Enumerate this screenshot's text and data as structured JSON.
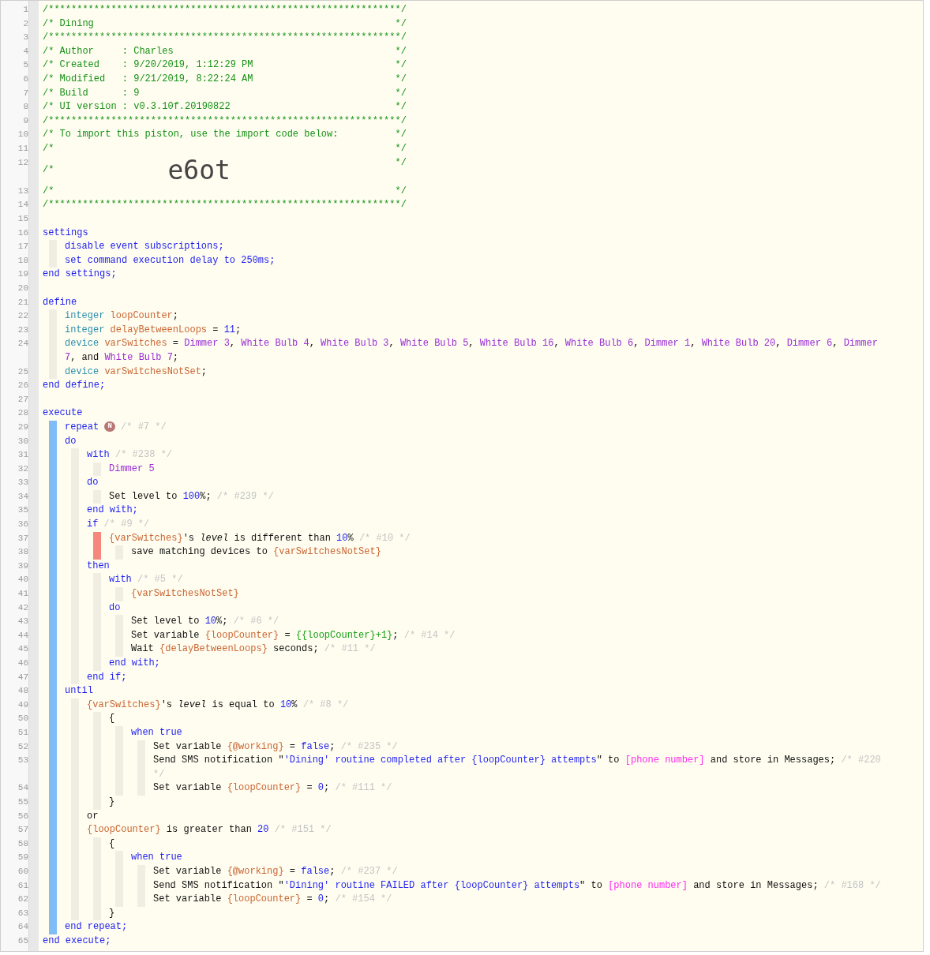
{
  "editor": {
    "lines": [
      {
        "number": "1",
        "segments": [
          {
            "kind": "cmt",
            "text": "/*************************************************************"
          }
        ],
        "close": "*/"
      },
      {
        "number": "2",
        "segments": [
          {
            "kind": "cmt",
            "text": "/* Dining"
          }
        ],
        "close": "*/"
      },
      {
        "number": "3",
        "segments": [
          {
            "kind": "cmt",
            "text": "/*************************************************************"
          }
        ],
        "close": "*/"
      },
      {
        "number": "4",
        "segments": [
          {
            "kind": "cmt",
            "text": "/* Author     : Charles"
          }
        ],
        "close": "*/"
      },
      {
        "number": "5",
        "segments": [
          {
            "kind": "cmt",
            "text": "/* Created    : 9/20/2019, 1:12:29 PM"
          }
        ],
        "close": "*/"
      },
      {
        "number": "6",
        "segments": [
          {
            "kind": "cmt",
            "text": "/* Modified   : 9/21/2019, 8:22:24 AM"
          }
        ],
        "close": "*/"
      },
      {
        "number": "7",
        "segments": [
          {
            "kind": "cmt",
            "text": "/* Build      : 9"
          }
        ],
        "close": "*/"
      },
      {
        "number": "8",
        "segments": [
          {
            "kind": "cmt",
            "text": "/* UI version : v0.3.10f.20190822"
          }
        ],
        "close": "*/"
      },
      {
        "number": "9",
        "segments": [
          {
            "kind": "cmt",
            "text": "/*************************************************************"
          }
        ],
        "close": "*/"
      },
      {
        "number": "10",
        "segments": [
          {
            "kind": "cmt",
            "text": "/* To import this piston, use the import code below:"
          }
        ],
        "close": "*/"
      },
      {
        "number": "11",
        "segments": [
          {
            "kind": "cmt",
            "text": "/*"
          }
        ],
        "close": "*/"
      },
      {
        "number": "12",
        "segments": [
          {
            "kind": "cmt",
            "text": "/*"
          },
          {
            "kind": "big",
            "text": "e6ot"
          }
        ],
        "close": "*/"
      },
      {
        "number": "13",
        "segments": [
          {
            "kind": "cmt",
            "text": "/*"
          }
        ],
        "close": "*/"
      },
      {
        "number": "14",
        "segments": [
          {
            "kind": "cmt",
            "text": "/*************************************************************"
          }
        ],
        "close": "*/"
      },
      {
        "number": "15"
      },
      {
        "number": "16",
        "segments": [
          {
            "kind": "kw",
            "text": "settings"
          }
        ],
        "children": [
          {
            "number": "17",
            "segments": [
              {
                "kind": "kw",
                "text": "disable event subscriptions;"
              }
            ]
          },
          {
            "number": "18",
            "segments": [
              {
                "kind": "kw",
                "text": "set command execution delay to 250ms;"
              }
            ]
          }
        ]
      },
      {
        "number": "19",
        "segments": [
          {
            "kind": "kw",
            "text": "end settings;"
          }
        ]
      },
      {
        "number": "20"
      },
      {
        "number": "21",
        "segments": [
          {
            "kind": "kw",
            "text": "define"
          }
        ],
        "children": [
          {
            "number": "22",
            "segments": [
              {
                "kind": "type",
                "text": "integer "
              },
              {
                "kind": "var",
                "text": "loopCounter"
              },
              {
                "kind": "txt",
                "text": ";"
              }
            ]
          },
          {
            "number": "23",
            "segments": [
              {
                "kind": "type",
                "text": "integer "
              },
              {
                "kind": "var",
                "text": "delayBetweenLoops"
              },
              {
                "kind": "txt",
                "text": " = "
              },
              {
                "kind": "num",
                "text": "11"
              },
              {
                "kind": "txt",
                "text": ";"
              }
            ]
          },
          {
            "number": "24",
            "segments": [
              {
                "kind": "type",
                "text": "device "
              },
              {
                "kind": "var",
                "text": "varSwitches"
              },
              {
                "kind": "txt",
                "text": " = "
              },
              {
                "kind": "dev",
                "text": "Dimmer 3"
              },
              {
                "kind": "txt",
                "text": ", "
              },
              {
                "kind": "dev",
                "text": "White Bulb 4"
              },
              {
                "kind": "txt",
                "text": ", "
              },
              {
                "kind": "dev",
                "text": "White Bulb 3"
              },
              {
                "kind": "txt",
                "text": ", "
              },
              {
                "kind": "dev",
                "text": "White Bulb 5"
              },
              {
                "kind": "txt",
                "text": ", "
              },
              {
                "kind": "dev",
                "text": "White Bulb 16"
              },
              {
                "kind": "txt",
                "text": ", "
              },
              {
                "kind": "dev",
                "text": "White Bulb 6"
              },
              {
                "kind": "txt",
                "text": ", "
              },
              {
                "kind": "dev",
                "text": "Dimmer 1"
              },
              {
                "kind": "txt",
                "text": ", "
              },
              {
                "kind": "dev",
                "text": "White Bulb 20"
              },
              {
                "kind": "txt",
                "text": ", "
              },
              {
                "kind": "dev",
                "text": "Dimmer 6"
              },
              {
                "kind": "txt",
                "text": ", "
              },
              {
                "kind": "dev",
                "text": "Dimmer 7"
              },
              {
                "kind": "txt",
                "text": ", and "
              },
              {
                "kind": "dev",
                "text": "White Bulb 7"
              },
              {
                "kind": "txt",
                "text": ";"
              }
            ]
          },
          {
            "number": "25",
            "segments": [
              {
                "kind": "type",
                "text": "device "
              },
              {
                "kind": "var",
                "text": "varSwitchesNotSet"
              },
              {
                "kind": "txt",
                "text": ";"
              }
            ]
          }
        ]
      },
      {
        "number": "26",
        "segments": [
          {
            "kind": "kw",
            "text": "end define;"
          }
        ]
      },
      {
        "number": "27"
      },
      {
        "number": "28",
        "segments": [
          {
            "kind": "kw",
            "text": "execute"
          }
        ],
        "color": "#80bdf7",
        "children": [
          {
            "number": "29",
            "segments": [
              {
                "kind": "kw",
                "text": "repeat "
              },
              {
                "kind": "badge",
                "text": "N"
              },
              {
                "kind": "dim",
                "text": " /* #7 */"
              }
            ]
          },
          {
            "number": "30",
            "segments": [
              {
                "kind": "kw",
                "text": "do"
              }
            ],
            "children": [
              {
                "number": "31",
                "segments": [
                  {
                    "kind": "kw",
                    "text": "with "
                  },
                  {
                    "kind": "dim",
                    "text": "/* #238 */"
                  }
                ],
                "children": [
                  {
                    "number": "32",
                    "segments": [
                      {
                        "kind": "dev",
                        "text": "Dimmer 5"
                      }
                    ]
                  }
                ]
              },
              {
                "number": "33",
                "segments": [
                  {
                    "kind": "kw",
                    "text": "do"
                  }
                ],
                "children": [
                  {
                    "number": "34",
                    "segments": [
                      {
                        "kind": "txt",
                        "text": "Set level to "
                      },
                      {
                        "kind": "num",
                        "text": "100"
                      },
                      {
                        "kind": "txt",
                        "text": "%; "
                      },
                      {
                        "kind": "dim",
                        "text": "/* #239 */"
                      }
                    ]
                  }
                ]
              },
              {
                "number": "35",
                "segments": [
                  {
                    "kind": "kw",
                    "text": "end with;"
                  }
                ]
              },
              {
                "number": "36",
                "segments": [
                  {
                    "kind": "kw",
                    "text": "if "
                  },
                  {
                    "kind": "dim",
                    "text": "/* #9 */"
                  }
                ],
                "color": "#f6877c",
                "children": [
                  {
                    "number": "37",
                    "segments": [
                      {
                        "kind": "var",
                        "text": "{varSwitches}"
                      },
                      {
                        "kind": "txt",
                        "text": "'s "
                      },
                      {
                        "kind": "it",
                        "text": "level"
                      },
                      {
                        "kind": "txt",
                        "text": " is different than "
                      },
                      {
                        "kind": "num",
                        "text": "10"
                      },
                      {
                        "kind": "txt",
                        "text": "% "
                      },
                      {
                        "kind": "dim",
                        "text": "/* #10 */"
                      }
                    ],
                    "children": [
                      {
                        "number": "38",
                        "segments": [
                          {
                            "kind": "txt",
                            "text": "save matching devices to "
                          },
                          {
                            "kind": "var",
                            "text": "{varSwitchesNotSet}"
                          }
                        ]
                      }
                    ]
                  }
                ]
              },
              {
                "number": "39",
                "segments": [
                  {
                    "kind": "kw",
                    "text": "then"
                  }
                ],
                "children": [
                  {
                    "number": "40",
                    "segments": [
                      {
                        "kind": "kw",
                        "text": "with "
                      },
                      {
                        "kind": "dim",
                        "text": "/* #5 */"
                      }
                    ],
                    "children": [
                      {
                        "number": "41",
                        "segments": [
                          {
                            "kind": "var",
                            "text": "{varSwitchesNotSet}"
                          }
                        ]
                      }
                    ]
                  },
                  {
                    "number": "42",
                    "segments": [
                      {
                        "kind": "kw",
                        "text": "do"
                      }
                    ],
                    "children": [
                      {
                        "number": "43",
                        "segments": [
                          {
                            "kind": "txt",
                            "text": "Set level to "
                          },
                          {
                            "kind": "num",
                            "text": "10"
                          },
                          {
                            "kind": "txt",
                            "text": "%; "
                          },
                          {
                            "kind": "dim",
                            "text": "/* #6 */"
                          }
                        ]
                      },
                      {
                        "number": "44",
                        "segments": [
                          {
                            "kind": "txt",
                            "text": "Set variable "
                          },
                          {
                            "kind": "var",
                            "text": "{loopCounter}"
                          },
                          {
                            "kind": "txt",
                            "text": " = "
                          },
                          {
                            "kind": "expr",
                            "text": "{{loopCounter}+1}"
                          },
                          {
                            "kind": "txt",
                            "text": "; "
                          },
                          {
                            "kind": "dim",
                            "text": "/* #14 */"
                          }
                        ]
                      },
                      {
                        "number": "45",
                        "segments": [
                          {
                            "kind": "txt",
                            "text": "Wait "
                          },
                          {
                            "kind": "var",
                            "text": "{delayBetweenLoops}"
                          },
                          {
                            "kind": "txt",
                            "text": " seconds; "
                          },
                          {
                            "kind": "dim",
                            "text": "/* #11 */"
                          }
                        ]
                      }
                    ]
                  },
                  {
                    "number": "46",
                    "segments": [
                      {
                        "kind": "kw",
                        "text": "end with;"
                      }
                    ]
                  }
                ]
              },
              {
                "number": "47",
                "segments": [
                  {
                    "kind": "kw",
                    "text": "end if;"
                  }
                ]
              }
            ]
          },
          {
            "number": "48",
            "segments": [
              {
                "kind": "kw",
                "text": "until"
              }
            ],
            "children": [
              {
                "number": "49",
                "segments": [
                  {
                    "kind": "var",
                    "text": "{varSwitches}"
                  },
                  {
                    "kind": "txt",
                    "text": "'s "
                  },
                  {
                    "kind": "it",
                    "text": "level"
                  },
                  {
                    "kind": "txt",
                    "text": " is equal to "
                  },
                  {
                    "kind": "num",
                    "text": "10"
                  },
                  {
                    "kind": "txt",
                    "text": "% "
                  },
                  {
                    "kind": "dim",
                    "text": "/* #8 */"
                  }
                ],
                "children": [
                  {
                    "number": "50",
                    "segments": [
                      {
                        "kind": "txt",
                        "text": "{"
                      }
                    ],
                    "children": [
                      {
                        "number": "51",
                        "segments": [
                          {
                            "kind": "kw",
                            "text": "when true"
                          }
                        ],
                        "children": [
                          {
                            "number": "52",
                            "segments": [
                              {
                                "kind": "txt",
                                "text": "Set variable "
                              },
                              {
                                "kind": "var",
                                "text": "{@working}"
                              },
                              {
                                "kind": "txt",
                                "text": " = "
                              },
                              {
                                "kind": "num",
                                "text": "false"
                              },
                              {
                                "kind": "txt",
                                "text": "; "
                              },
                              {
                                "kind": "dim",
                                "text": "/* #235 */"
                              }
                            ]
                          },
                          {
                            "number": "53",
                            "segments": [
                              {
                                "kind": "txt",
                                "text": "Send SMS notification \""
                              },
                              {
                                "kind": "str",
                                "text": "'Dining' routine completed after {loopCounter} attempts"
                              },
                              {
                                "kind": "txt",
                                "text": "\" to "
                              },
                              {
                                "kind": "ph",
                                "text": "[phone number]"
                              },
                              {
                                "kind": "txt",
                                "text": " and store in Messages; "
                              },
                              {
                                "kind": "dim",
                                "text": "/* #220 */"
                              }
                            ]
                          },
                          {
                            "number": "54",
                            "segments": [
                              {
                                "kind": "txt",
                                "text": "Set variable "
                              },
                              {
                                "kind": "var",
                                "text": "{loopCounter}"
                              },
                              {
                                "kind": "txt",
                                "text": " = "
                              },
                              {
                                "kind": "num",
                                "text": "0"
                              },
                              {
                                "kind": "txt",
                                "text": "; "
                              },
                              {
                                "kind": "dim",
                                "text": "/* #111 */"
                              }
                            ]
                          }
                        ]
                      }
                    ]
                  },
                  {
                    "number": "55",
                    "segments": [
                      {
                        "kind": "txt",
                        "text": "}"
                      }
                    ]
                  }
                ]
              },
              {
                "number": "56",
                "segments": [
                  {
                    "kind": "txt",
                    "text": "or"
                  }
                ]
              },
              {
                "number": "57",
                "segments": [
                  {
                    "kind": "var",
                    "text": "{loopCounter}"
                  },
                  {
                    "kind": "txt",
                    "text": " is greater than "
                  },
                  {
                    "kind": "num",
                    "text": "20"
                  },
                  {
                    "kind": "dim",
                    "text": " /* #151 */"
                  }
                ],
                "children": [
                  {
                    "number": "58",
                    "segments": [
                      {
                        "kind": "txt",
                        "text": "{"
                      }
                    ],
                    "children": [
                      {
                        "number": "59",
                        "segments": [
                          {
                            "kind": "kw",
                            "text": "when true"
                          }
                        ],
                        "children": [
                          {
                            "number": "60",
                            "segments": [
                              {
                                "kind": "txt",
                                "text": "Set variable "
                              },
                              {
                                "kind": "var",
                                "text": "{@working}"
                              },
                              {
                                "kind": "txt",
                                "text": " = "
                              },
                              {
                                "kind": "num",
                                "text": "false"
                              },
                              {
                                "kind": "txt",
                                "text": "; "
                              },
                              {
                                "kind": "dim",
                                "text": "/* #237 */"
                              }
                            ]
                          },
                          {
                            "number": "61",
                            "segments": [
                              {
                                "kind": "txt",
                                "text": "Send SMS notification \""
                              },
                              {
                                "kind": "str",
                                "text": "'Dining' routine FAILED after {loopCounter} attempts"
                              },
                              {
                                "kind": "txt",
                                "text": "\" to "
                              },
                              {
                                "kind": "ph",
                                "text": "[phone number]"
                              },
                              {
                                "kind": "txt",
                                "text": " and store in Messages; "
                              },
                              {
                                "kind": "dim",
                                "text": "/* #168 */"
                              }
                            ]
                          },
                          {
                            "number": "62",
                            "segments": [
                              {
                                "kind": "txt",
                                "text": "Set variable "
                              },
                              {
                                "kind": "var",
                                "text": "{loopCounter}"
                              },
                              {
                                "kind": "txt",
                                "text": " = "
                              },
                              {
                                "kind": "num",
                                "text": "0"
                              },
                              {
                                "kind": "txt",
                                "text": "; "
                              },
                              {
                                "kind": "dim",
                                "text": "/* #154 */"
                              }
                            ]
                          }
                        ]
                      }
                    ]
                  },
                  {
                    "number": "63",
                    "segments": [
                      {
                        "kind": "txt",
                        "text": "}"
                      }
                    ]
                  }
                ]
              }
            ]
          },
          {
            "number": "64",
            "segments": [
              {
                "kind": "kw",
                "text": "end repeat;"
              }
            ]
          }
        ]
      },
      {
        "number": "65",
        "segments": [
          {
            "kind": "kw",
            "text": "end execute;"
          }
        ]
      }
    ]
  }
}
